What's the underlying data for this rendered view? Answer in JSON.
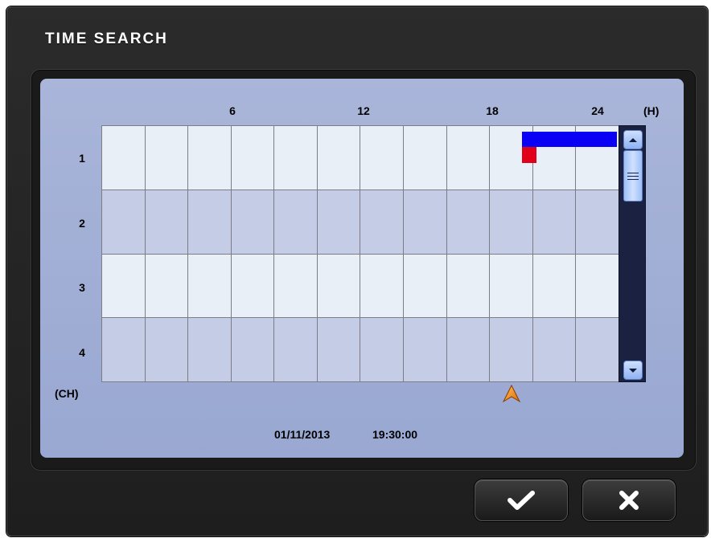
{
  "dialog": {
    "title": "TIME SEARCH"
  },
  "timeline": {
    "hour_ticks": [
      "6",
      "12",
      "18",
      "24"
    ],
    "hour_unit": "(H)",
    "channel_unit": "(CH)",
    "channels": [
      "1",
      "2",
      "3",
      "4"
    ]
  },
  "recordings": [
    {
      "channel": "1",
      "type": "continuous",
      "color": "#0a00f5"
    },
    {
      "channel": "1",
      "type": "event",
      "color": "#e0001a"
    }
  ],
  "marker": {
    "icon": "current-time-arrow-icon",
    "color": "#f08a1e"
  },
  "status": {
    "date": "01/11/2013",
    "time": "19:30:00"
  },
  "buttons": {
    "confirm_icon": "checkmark-icon",
    "cancel_icon": "close-icon"
  },
  "colors": {
    "panel": "#a9b5d9",
    "grid_light": "#e9eff6",
    "grid_dark": "#c5cce6",
    "scrollbar": "#1b2140"
  }
}
